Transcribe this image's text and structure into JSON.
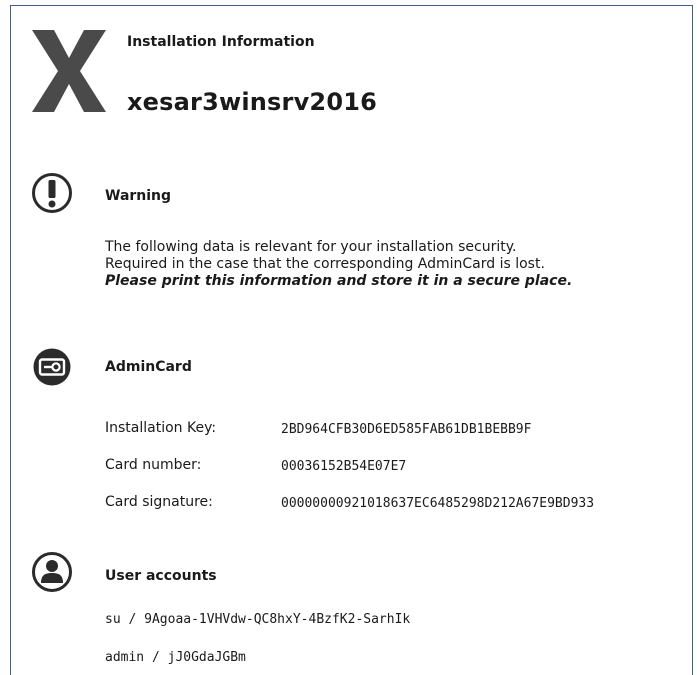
{
  "header": {
    "subtitle": "Installation Information",
    "hostname": "xesar3winsrv2016"
  },
  "colors": {
    "frame": "#3f5f8a",
    "logo": "#4a4a4a",
    "icon": "#2b2b2b",
    "text": "#1a1a1a"
  },
  "warning": {
    "icon": "exclamation-circle-icon",
    "title": "Warning",
    "line1": "The following data is relevant for your installation security.",
    "line2": "Required in the case that the corresponding AdminCard is lost.",
    "line3": "Please print this information and store it in a secure place."
  },
  "admincard": {
    "icon": "key-card-circle-icon",
    "title": "AdminCard",
    "rows": [
      {
        "label": "Installation Key:",
        "value": "2BD964CFB30D6ED585FAB61DB1BEBB9F"
      },
      {
        "label": "Card number:",
        "value": "00036152B54E07E7"
      },
      {
        "label": "Card signature:",
        "value": "0000000092101863​7EC6485298D212A67E9BD933"
      }
    ]
  },
  "accounts": {
    "icon": "user-circle-icon",
    "title": "User accounts",
    "items": [
      "su / 9Agoaa-1VHVdw-QC8hxY-4BzfK2-SarhIk",
      "admin / jJ0GdaJGBm"
    ]
  }
}
